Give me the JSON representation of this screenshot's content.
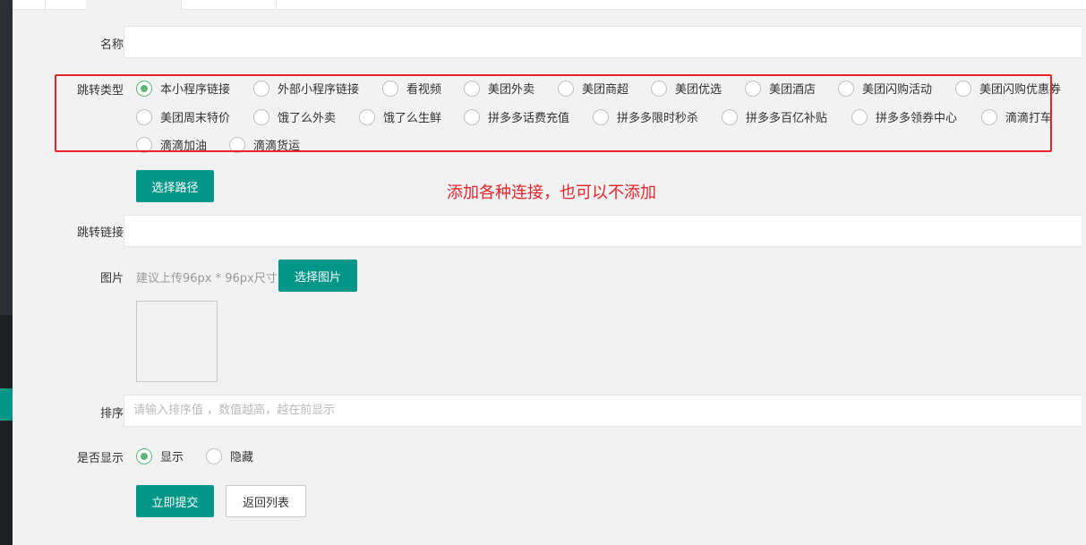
{
  "form": {
    "name_label": "名称",
    "name_value": "",
    "jump_type_label": "跳转类型",
    "jump_types": [
      {
        "label": "本小程序链接",
        "checked": true
      },
      {
        "label": "外部小程序链接",
        "checked": false
      },
      {
        "label": "看视频",
        "checked": false
      },
      {
        "label": "美团外卖",
        "checked": false
      },
      {
        "label": "美团商超",
        "checked": false
      },
      {
        "label": "美团优选",
        "checked": false
      },
      {
        "label": "美团酒店",
        "checked": false
      },
      {
        "label": "美团闪购活动",
        "checked": false
      },
      {
        "label": "美团闪购优惠券",
        "checked": false
      },
      {
        "label": "美团周末特价",
        "checked": false
      },
      {
        "label": "饿了么外卖",
        "checked": false
      },
      {
        "label": "饿了么生鲜",
        "checked": false
      },
      {
        "label": "拼多多话费充值",
        "checked": false
      },
      {
        "label": "拼多多限时秒杀",
        "checked": false
      },
      {
        "label": "拼多多百亿补贴",
        "checked": false
      },
      {
        "label": "拼多多领券中心",
        "checked": false
      },
      {
        "label": "滴滴打车",
        "checked": false
      },
      {
        "label": "滴滴加油",
        "checked": false
      },
      {
        "label": "滴滴货运",
        "checked": false
      }
    ],
    "select_path_button": "选择路径",
    "annotation": "添加各种连接，也可以不添加",
    "jump_link_label": "跳转链接",
    "jump_link_value": "",
    "image_label": "图片",
    "image_hint": "建议上传96px * 96px尺寸",
    "select_image_button": "选择图片",
    "sort_label": "排序",
    "sort_placeholder": "请输入排序值 ，数值越高，越在前显示",
    "display_label": "是否显示",
    "display_options": [
      {
        "label": "显示",
        "checked": true
      },
      {
        "label": "隐藏",
        "checked": false
      }
    ],
    "submit_button": "立即提交",
    "back_button": "返回列表"
  },
  "colors": {
    "primary": "#009688",
    "radio_checked": "#5fb878",
    "annotation_red": "#e8242b"
  }
}
